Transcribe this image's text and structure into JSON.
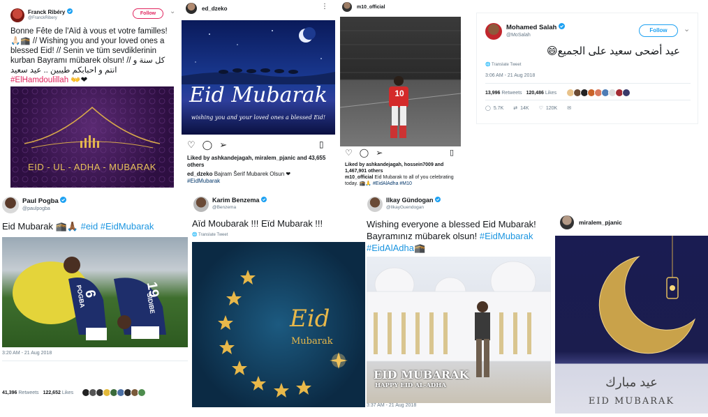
{
  "ribery": {
    "name": "Franck Ribéry",
    "handle": "@FranckRibery",
    "follow": "Follow",
    "text": "Bonne Fête de l'Aïd à vous et votre familles! 🙏🏻🕋 // Wishing you and your loved ones a blessed Eid! // Senin ve tüm sevdiklerinin kurban Bayramı mübarek olsun! // كل سنة و انتم و احبابكم طيبين .. عيد سعيد",
    "hashtag": "#ElHamdoulillah",
    "emoji": "👐❤",
    "image_text": "EID - UL - ADHA - MUBARAK"
  },
  "dzeko": {
    "username": "ed_dzeko",
    "image_title": "Eid Mubarak",
    "image_sub": "wishing you and your loved ones a blessed Eid!",
    "liked_by": "Liked by ashkandejagah, miralem_pjanic and 43,655 others",
    "caption_user": "ed_dzeko",
    "caption": "Bajram Šerif Mubarek Olsun ❤",
    "hashtag": "#EidMubarak"
  },
  "ozil": {
    "username": "m10_official",
    "shirt_number": "10",
    "liked_by": "Liked by ashkandejagah, hossein7009 and 1,467,901 others",
    "caption_user": "m10_official",
    "caption": "Eid Mubarak to all of you celebrating today. 🕋🙏 ",
    "hashtags": "#EidAlAdha #M10"
  },
  "salah": {
    "name": "Mohamed Salah",
    "handle": "@MoSalah",
    "follow": "Follow",
    "text": "عيد أضحى سعيد على الجميع😄",
    "translate": "Translate Tweet",
    "time": "3:06 AM - 21 Aug 2018",
    "retweets": "13,996",
    "retweets_label": "Retweets",
    "likes": "120,486",
    "likes_label": "Likes",
    "replies_count": "5.7K",
    "rt_count": "14K",
    "like_count": "120K"
  },
  "pogba": {
    "name": "Paul Pogba",
    "handle": "@paulpogba",
    "text": "Eid Mubarak 🕋🙏🏾",
    "hashtags": "#eid #EidMubarak",
    "shirt_left": "POGBA",
    "shirt_right": "SIDIBE",
    "num_left": "6",
    "num_right": "19",
    "time": "3:20 AM - 21 Aug 2018",
    "retweets": "41,396",
    "retweets_label": "Retweets",
    "likes": "122,652",
    "likes_label": "Likes"
  },
  "benzema": {
    "name": "Karim Benzema",
    "handle": "@Benzema",
    "text": "Aïd Moubarak !!! Eïd Mubarak !!!",
    "translate": "Translate Tweet",
    "image_title": "Eid",
    "image_sub": "Mubarak"
  },
  "gundogan": {
    "name": "Ilkay Gündogan",
    "handle": "@IlkayGuendogan",
    "text1": "Wishing everyone a blessed Eid Mubarak!",
    "text2": "Bayramınız mübarek olsun!",
    "hashtag1": "#EidMubarak",
    "hashtag2": "#EidAlAdha",
    "emoji": "🕋",
    "banner1": "EID MUBARAK",
    "banner2": "HAPPY EID AL-ADHA",
    "time": "3:37 AM - 21 Aug 2018"
  },
  "pjanic": {
    "username": "miralem_pjanic",
    "image_arabic": "عيد مبارك",
    "image_title": "EID MUBARAK"
  },
  "colors": {
    "twitter_blue": "#1da1f2",
    "follow_red": "#e0245e",
    "hashtag_red": "#e0245e",
    "hashtag_blue": "#1b95e0"
  }
}
